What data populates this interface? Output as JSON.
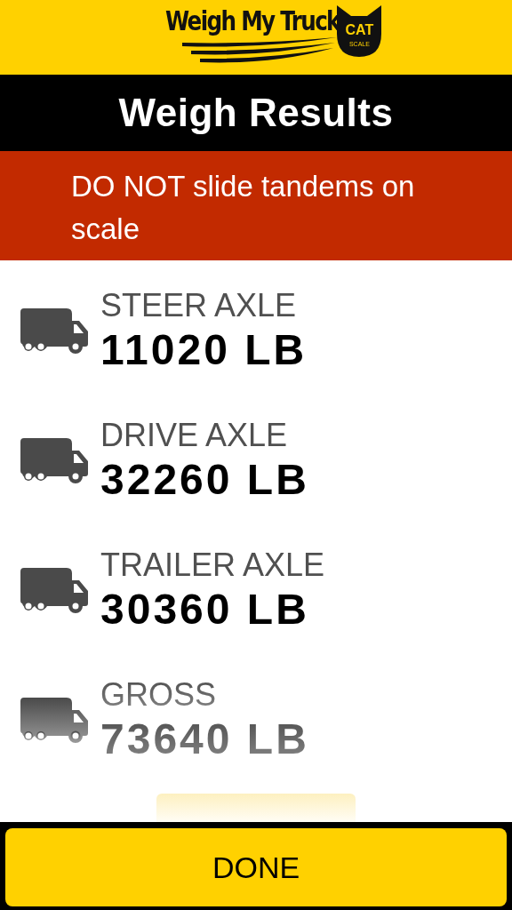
{
  "logo": {
    "text": "Weigh My Truck",
    "badge": "CAT",
    "badge_sub": "SCALE"
  },
  "title": "Weigh Results",
  "warning": "DO NOT slide tandems on scale",
  "results": [
    {
      "label": "STEER AXLE",
      "value": "11020 LB",
      "faded": false
    },
    {
      "label": "DRIVE AXLE",
      "value": "32260 LB",
      "faded": false
    },
    {
      "label": "TRAILER AXLE",
      "value": "30360 LB",
      "faded": false
    },
    {
      "label": "GROSS",
      "value": "73640 LB",
      "faded": true
    }
  ],
  "done_button": "DONE"
}
